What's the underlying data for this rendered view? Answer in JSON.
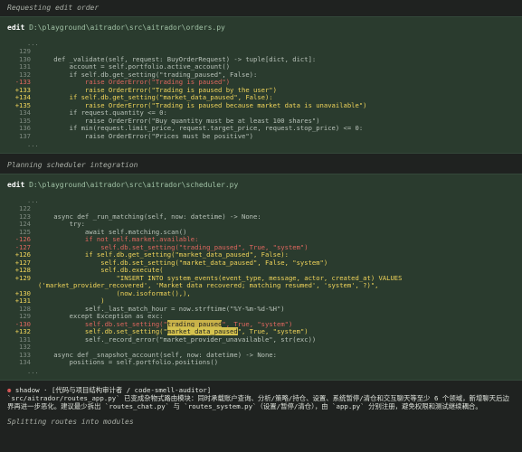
{
  "status1": "Requesting edit order",
  "panel1": {
    "action": "edit",
    "path": "D:\\playground\\aitrador\\src\\aitrador\\orders.py",
    "ellipsis_top": "...",
    "ellipsis_bottom": "...",
    "lines": [
      {
        "num": "129",
        "type": "ctx",
        "text": ""
      },
      {
        "num": "130",
        "type": "ctx",
        "text": "    def _validate(self, request: BuyOrderRequest) -> tuple[dict, dict]:"
      },
      {
        "num": "131",
        "type": "ctx",
        "text": "        account = self.portfolio.active_account()"
      },
      {
        "num": "132",
        "type": "ctx",
        "text": "        if self.db.get_setting(\"trading_paused\", False):"
      },
      {
        "num": "-133",
        "type": "rm",
        "text": "            raise OrderError(\"Trading is paused\")"
      },
      {
        "num": "+133",
        "type": "add",
        "text": "            raise OrderError(\"Trading is paused by the user\")"
      },
      {
        "num": "+134",
        "type": "add",
        "text": "        if self.db.get_setting(\"market_data_paused\", False):"
      },
      {
        "num": "+135",
        "type": "add",
        "text": "            raise OrderError(\"Trading is paused because market data is unavailable\")"
      },
      {
        "num": "134",
        "type": "ctx",
        "text": "        if request.quantity <= 0:"
      },
      {
        "num": "135",
        "type": "ctx",
        "text": "            raise OrderError(\"Buy quantity must be at least 100 shares\")"
      },
      {
        "num": "136",
        "type": "ctx",
        "text": "        if min(request.limit_price, request.target_price, request.stop_price) <= 0:"
      },
      {
        "num": "137",
        "type": "ctx",
        "text": "            raise OrderError(\"Prices must be positive\")"
      }
    ]
  },
  "status2": "Planning scheduler integration",
  "panel2": {
    "action": "edit",
    "path": "D:\\playground\\aitrador\\src\\aitrador\\scheduler.py",
    "ellipsis_top": "...",
    "ellipsis_bottom": "...",
    "lines": [
      {
        "num": "122",
        "type": "ctx",
        "text": ""
      },
      {
        "num": "123",
        "type": "ctx",
        "text": "    async def _run_matching(self, now: datetime) -> None:"
      },
      {
        "num": "124",
        "type": "ctx",
        "text": "        try:"
      },
      {
        "num": "125",
        "type": "ctx",
        "text": "            await self.matching.scan()"
      },
      {
        "num": "-126",
        "type": "rm",
        "text": "            if not self.market.available:"
      },
      {
        "num": "-127",
        "type": "rm",
        "text": "                self.db.set_setting(\"trading_paused\", True, \"system\")"
      },
      {
        "num": "+126",
        "type": "add",
        "text": "            if self.db.get_setting(\"market_data_paused\", False):"
      },
      {
        "num": "+127",
        "type": "add",
        "text": "                self.db.set_setting(\"market_data_paused\", False, \"system\")"
      },
      {
        "num": "+128",
        "type": "add",
        "text": "                self.db.execute("
      },
      {
        "num": "+129",
        "type": "add",
        "text": "                    \"INSERT INTO system_events(event_type, message, actor, created_at) VALUES ('market_provider_recovered', 'Market data recovered; matching resumed', 'system', ?)\",",
        "wrap": true
      },
      {
        "num": "+130",
        "type": "add",
        "text": "                    (now.isoformat(),),"
      },
      {
        "num": "+131",
        "type": "add",
        "text": "                )"
      },
      {
        "num": "128",
        "type": "ctx",
        "text": "            self._last_match_hour = now.strftime(\"%Y-%m-%d-%H\")"
      },
      {
        "num": "129",
        "type": "ctx",
        "text": "        except Exception as exc:"
      },
      {
        "num": "-130",
        "type": "rm",
        "pre": "            self.db.set_setting(\"",
        "hl": "trading_paused",
        "post": "\", True, \"system\")"
      },
      {
        "num": "+132",
        "type": "add",
        "pre": "            self.db.set_setting(\"",
        "hl": "market_data_paused",
        "post": "\", True, \"system\")"
      },
      {
        "num": "131",
        "type": "ctx",
        "text": "            self._record_error(\"market_provider_unavailable\", str(exc))"
      },
      {
        "num": "132",
        "type": "ctx",
        "text": ""
      },
      {
        "num": "133",
        "type": "ctx",
        "text": "    async def _snapshot_account(self, now: datetime) -> None:"
      },
      {
        "num": "134",
        "type": "ctx",
        "text": "        positions = self.portfolio.positions()"
      }
    ]
  },
  "shadow": {
    "icon": "ghost-icon",
    "header": "shadow · [代码与项目结构审计者 / code-smell-auditor]",
    "body": "`src/aitrador/routes_app.py` 已变成杂物式路由模块：同时承载账户查询、分析/策略/持仓、设置、系统暂停/清仓和交互聊天等至少 6 个领域，新增聊天后边界再进一步恶化。建议最少拆出 `routes_chat.py` 与 `routes_system.py`（设置/暂停/清仓），由 `app.py` 分别注册，避免权限和测试继续耦合。"
  },
  "status3": "Splitting routes into modules"
}
